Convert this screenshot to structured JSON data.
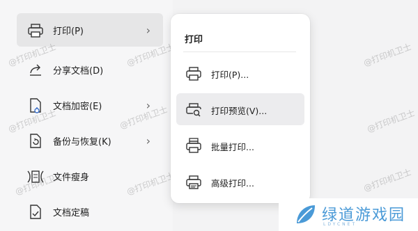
{
  "menu": {
    "items": [
      {
        "label": "打印(P)",
        "icon": "printer-icon",
        "has_submenu": true,
        "active": true
      },
      {
        "label": "分享文档(D)",
        "icon": "share-icon",
        "has_submenu": false
      },
      {
        "label": "文档加密(E)",
        "icon": "lock-document-icon",
        "has_submenu": true
      },
      {
        "label": "备份与恢复(K)",
        "icon": "backup-icon",
        "has_submenu": true
      },
      {
        "label": "文件瘦身",
        "icon": "compress-file-icon",
        "has_submenu": false
      },
      {
        "label": "文档定稿",
        "icon": "finalize-document-icon",
        "has_submenu": false
      }
    ]
  },
  "submenu": {
    "title": "打印",
    "items": [
      {
        "label": "打印(P)...",
        "icon": "printer-icon"
      },
      {
        "label": "打印预览(V)...",
        "icon": "print-preview-icon"
      },
      {
        "label": "批量打印...",
        "icon": "batch-print-icon"
      },
      {
        "label": "高级打印...",
        "icon": "advanced-print-icon"
      }
    ]
  },
  "watermark": "@打印机卫士",
  "logo": {
    "name": "绿道游戏园",
    "sub": "LDYCNET",
    "color": "#4a9ad7"
  }
}
